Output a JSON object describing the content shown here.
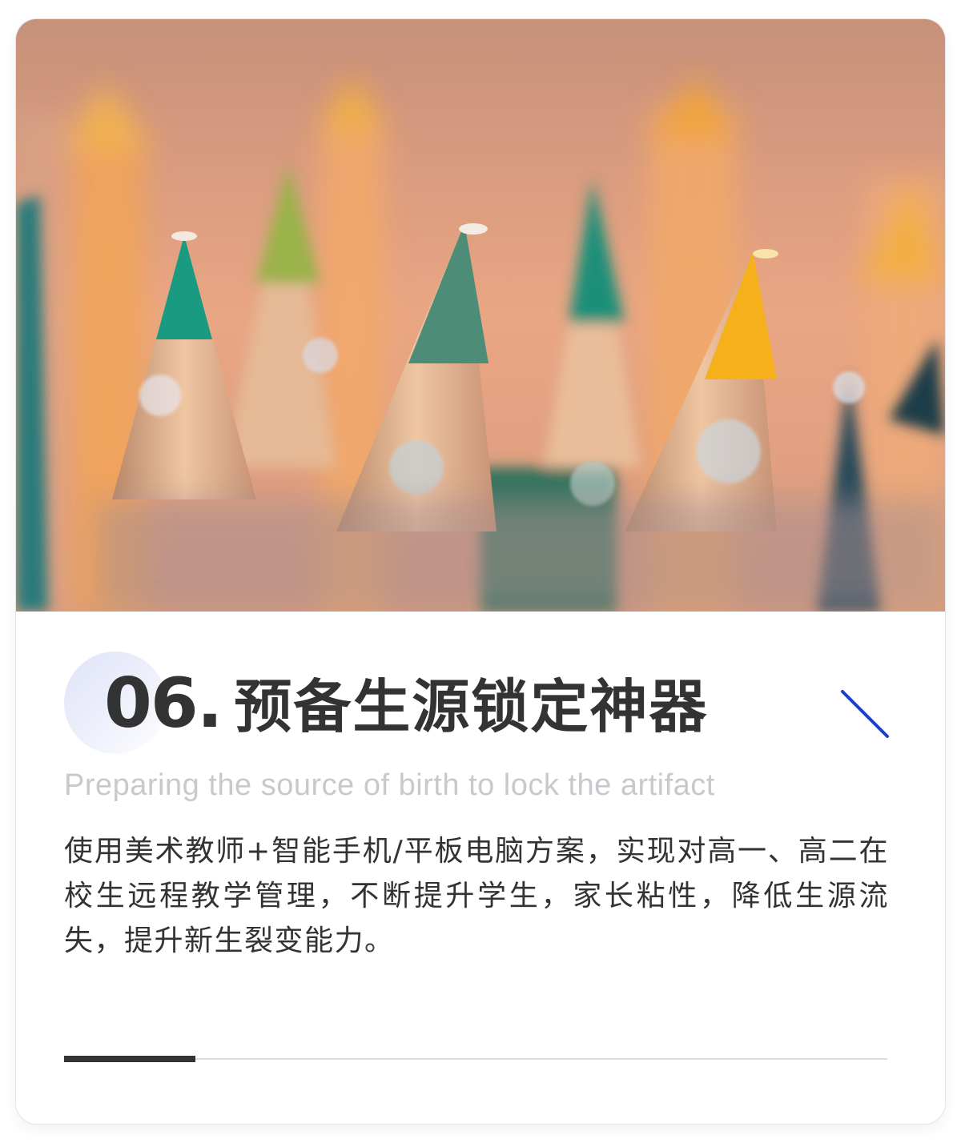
{
  "hero": {
    "image_description": "close-up photo of sharpened colored pencils"
  },
  "section": {
    "number": "06",
    "dot": ".",
    "title": "预备生源锁定神器",
    "subtitle": "Preparing the source of birth to lock the artifact",
    "body": "使用美术教师+智能手机/平板电脑方案，实现对高一、高二在校生远程教学管理，不断提升学生，家长粘性，降低生源流失，提升新生裂变能力。"
  },
  "colors": {
    "accent_blue": "#1f3fc8",
    "text_dark": "#333333",
    "subtitle_gray": "#c9c9cd"
  },
  "icons": {
    "diagonal": "diagonal-line-icon"
  }
}
